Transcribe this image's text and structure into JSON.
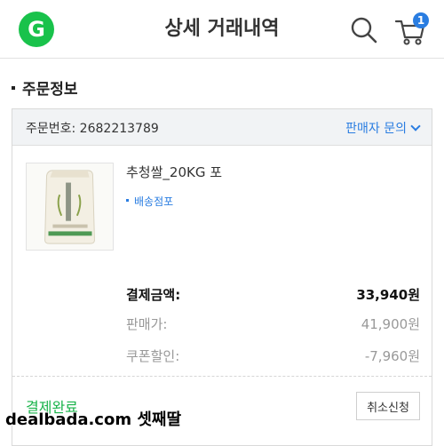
{
  "header": {
    "logo_letter": "G",
    "title": "상세 거래내역",
    "cart_count": "1"
  },
  "section": {
    "title": "주문정보"
  },
  "order": {
    "order_number": "주문번호: 2682213789",
    "seller_inquiry": "판매자 문의",
    "product_name": "추청쌀_20KG 포",
    "shipping": "배송점포",
    "payment_label": "결제금액:",
    "payment_value": "33,940원",
    "price_label": "판매가:",
    "price_value": "41,900원",
    "coupon_label": "쿠폰할인:",
    "coupon_value": "-7,960원",
    "status": "결제완료",
    "cancel_label": "취소신청"
  },
  "watermark": "dealbada.com 셋째딸",
  "colors": {
    "brand": "#19c24b",
    "accent": "#2a7de1"
  }
}
